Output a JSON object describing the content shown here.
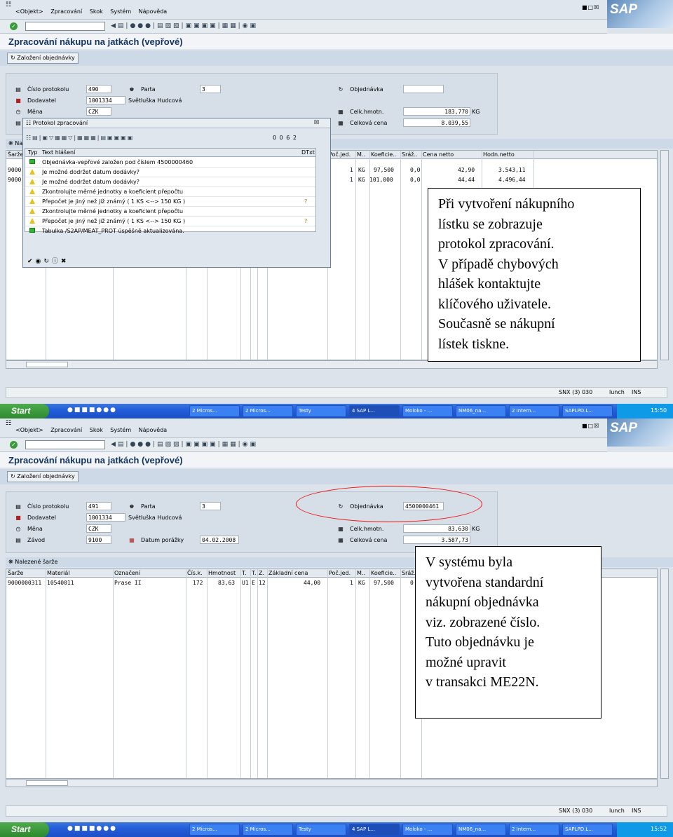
{
  "menu": [
    "<Objekt>",
    "Zpracování",
    "Skok",
    "Systém",
    "Nápověda"
  ],
  "brand": "SAP",
  "screen_title": "Zpracování nákupu na jatkách (vepřové)",
  "app_button": "Založení objednávky",
  "labels": {
    "protocol": "Číslo protokolu",
    "party": "Parta",
    "supplier": "Dodavatel",
    "currency": "Měna",
    "plant": "Závod",
    "order_date": "Datum porážky",
    "order": "Objednávka",
    "total_weight": "Celk.hmotn.",
    "total_price": "Celková cena",
    "grid_title": "Nalezené šarže"
  },
  "grid_headers": [
    "Šarže",
    "Materiál",
    "Označení",
    "Čís.k.",
    "Hmotnost",
    "T.",
    "T.",
    "Z.",
    "Základní cena",
    "Poč.jed.",
    "M..",
    "Koeficie..",
    "Sráž..",
    "Cena netto",
    "Hodn.netto"
  ],
  "screen1": {
    "protocol": "490",
    "party": "3",
    "supplier_id": "1001334",
    "supplier_name": "Světluška Hudcová",
    "currency": "CZK",
    "order": "",
    "total_weight": "183,770",
    "weight_unit": "KG",
    "total_price": "8.039,55",
    "rows": [
      {
        "sarze": "9000",
        "poc": "1",
        "m": "KG",
        "koef": "97,500",
        "sraz": "0,0",
        "cena": "42,90",
        "hodn": "3.543,11"
      },
      {
        "sarze": "9000",
        "poc": "1",
        "m": "KG",
        "koef": "101,000",
        "sraz": "0,0",
        "cena": "44,44",
        "hodn": "4.496,44"
      }
    ],
    "popup": {
      "title": "Protokol zpracování",
      "col_type": "Typ",
      "col_text": "Text hlášení",
      "col_dtxt": "DTxt",
      "counts": "0  0  6  2",
      "messages": [
        {
          "type": "g",
          "text": "Objednávka-vepřové založen pod číslem 4500000460",
          "info": ""
        },
        {
          "type": "w",
          "text": "Je možné dodržet datum dodávky?",
          "info": ""
        },
        {
          "type": "w",
          "text": "Je možné dodržet datum dodávky?",
          "info": ""
        },
        {
          "type": "w",
          "text": "Zkontrolujte měrné jednotky a koeficient přepočtu",
          "info": ""
        },
        {
          "type": "w",
          "text": "Přepočet je jiný než již známý  ( 1 KS <--> 150 KG )",
          "info": "?"
        },
        {
          "type": "w",
          "text": "Zkontrolujte měrné jednotky a koeficient přepočtu",
          "info": ""
        },
        {
          "type": "w",
          "text": "Přepočet je jiný než již známý  ( 1 KS <--> 150 KG )",
          "info": "?"
        },
        {
          "type": "g",
          "text": "Tabulka /S2AP/MEAT_PROT úspěšně aktualizována.",
          "info": ""
        }
      ]
    },
    "callout": [
      "Při vytvoření nákupního",
      "lístku se zobrazuje",
      "protokol zpracování.",
      "V případě chybových",
      "hlášek kontaktujte",
      "klíčového uživatele.",
      "Současně se nákupní",
      "lístek tiskne."
    ],
    "time": "15:50"
  },
  "screen2": {
    "protocol": "491",
    "party": "3",
    "supplier_id": "1001334",
    "supplier_name": "Světluška Hudcová",
    "currency": "CZK",
    "plant": "9100",
    "order_date": "04.02.2008",
    "order": "4500000461",
    "total_weight": "83,630",
    "weight_unit": "KG",
    "total_price": "3.587,73",
    "rows": [
      {
        "sarze": "9000000311",
        "material": "10540011",
        "oznaceni": "Prase II",
        "cisk": "172",
        "hmot": "83,63",
        "t1": "U1",
        "t2": "E",
        "z": "12",
        "zakl": "44,00",
        "poc": "1",
        "m": "KG",
        "koef": "97,500",
        "sraz": "0"
      }
    ],
    "callout": [
      "V systému byla",
      "vytvořena standardní",
      "nákupní objednávka",
      "viz. zobrazené číslo.",
      "Tuto objednávku je",
      "možné upravit",
      "v transakci ME22N."
    ],
    "time": "15:52"
  },
  "status": {
    "system": "SNX (3) 030",
    "server": "lunch",
    "mode": "INS"
  },
  "taskbar": {
    "start": "Start",
    "tasks": [
      "2 Micros...",
      "2 Micros...",
      "Testy",
      "4 SAP L...",
      "Moloko - ...",
      "NM06_na...",
      "2 Intern...",
      "SAPLPD.L..."
    ]
  }
}
